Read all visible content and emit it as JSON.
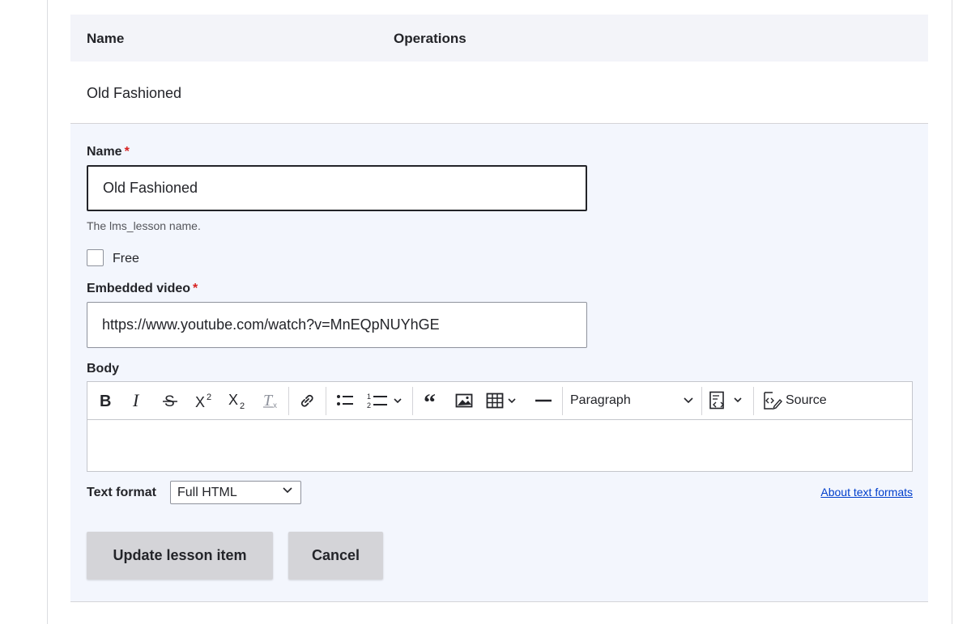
{
  "table": {
    "col_name": "Name",
    "col_operations": "Operations",
    "row_name": "Old Fashioned"
  },
  "form": {
    "name_label": "Name",
    "required_mark": "*",
    "name_value": "Old Fashioned",
    "name_description": "The lms_lesson name.",
    "free_label": "Free",
    "free_checked": false,
    "video_label": "Embedded video",
    "video_value": "https://www.youtube.com/watch?v=MnEQpNUYhGE",
    "body_label": "Body",
    "toolbar": {
      "paragraph": "Paragraph",
      "source": "Source"
    },
    "text_format_label": "Text format",
    "text_format_value": "Full HTML",
    "about_link": "About text formats",
    "update_button": "Update lesson item",
    "cancel_button": "Cancel"
  },
  "colors": {
    "required": "#d72222",
    "panel_bg": "#f3f6fd",
    "button_bg": "#d4d4d8",
    "link": "#003ecc"
  },
  "icons": {
    "toolbar": [
      "bold-icon",
      "italic-icon",
      "strikethrough-icon",
      "superscript-icon",
      "subscript-icon",
      "remove-format-icon",
      "link-icon",
      "bulleted-list-icon",
      "numbered-list-icon",
      "blockquote-icon",
      "image-icon",
      "table-icon",
      "horizontal-line-icon",
      "code-block-icon",
      "source-icon"
    ]
  }
}
